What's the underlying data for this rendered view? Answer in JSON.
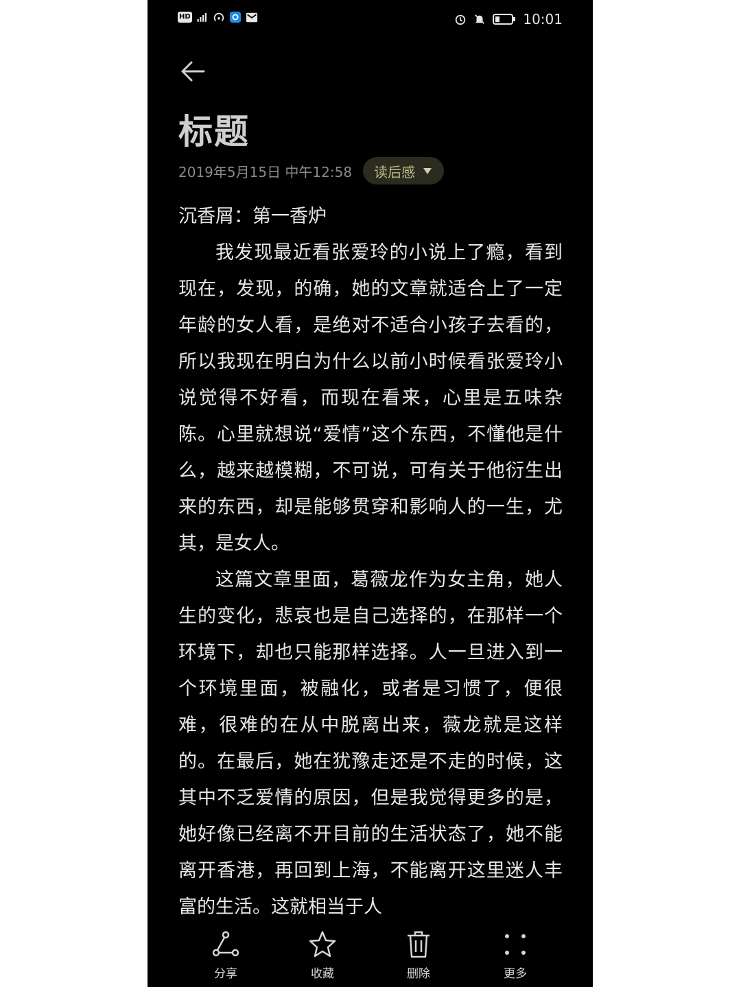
{
  "status_bar": {
    "left_icons": [
      "hd-icon",
      "signal-4g-icon",
      "hotspot-icon",
      "app-notification-icon",
      "mail-notification-icon"
    ],
    "hd_label": "HD",
    "right_icons": [
      "alarm-icon",
      "mute-icon",
      "battery-icon"
    ],
    "time": "10:01"
  },
  "header": {
    "back_icon": "back-arrow-icon",
    "title": "标题",
    "date": "2019年5月15日 中午12:58",
    "category": "读后感"
  },
  "note": {
    "paragraphs": [
      {
        "indent": false,
        "text": "沉香屑：第一香炉"
      },
      {
        "indent": true,
        "text": "我发现最近看张爱玲的小说上了瘾，看到现在，发现，的确，她的文章就适合上了一定年龄的女人看，是绝对不适合小孩子去看的，所以我现在明白为什么以前小时候看张爱玲小说觉得不好看，而现在看来，心里是五味杂陈。心里就想说“爱情”这个东西，不懂他是什么，越来越模糊，不可说，可有关于他衍生出来的东西，却是能够贯穿和影响人的一生，尤其，是女人。"
      },
      {
        "indent": true,
        "text": "这篇文章里面，葛薇龙作为女主角，她人生的变化，悲哀也是自己选择的，在那样一个环境下，却也只能那样选择。人一旦进入到一个环境里面，被融化，或者是习惯了，便很难，很难的在从中脱离出来，薇龙就是这样的。在最后，她在犹豫走还是不走的时候，这其中不乏爱情的原因，但是我觉得更多的是，她好像已经离不开目前的生活状态了，她不能离开香港，再回到上海，不能离开这里迷人丰富的生活。这就相当于人"
      }
    ]
  },
  "toolbar": {
    "share": "分享",
    "favorite": "收藏",
    "delete": "删除",
    "more": "更多"
  },
  "colors": {
    "background": "#000000",
    "text": "#e6e6e6",
    "tag_bg": "#2b2b1f",
    "tag_text": "#bdbd8a"
  }
}
